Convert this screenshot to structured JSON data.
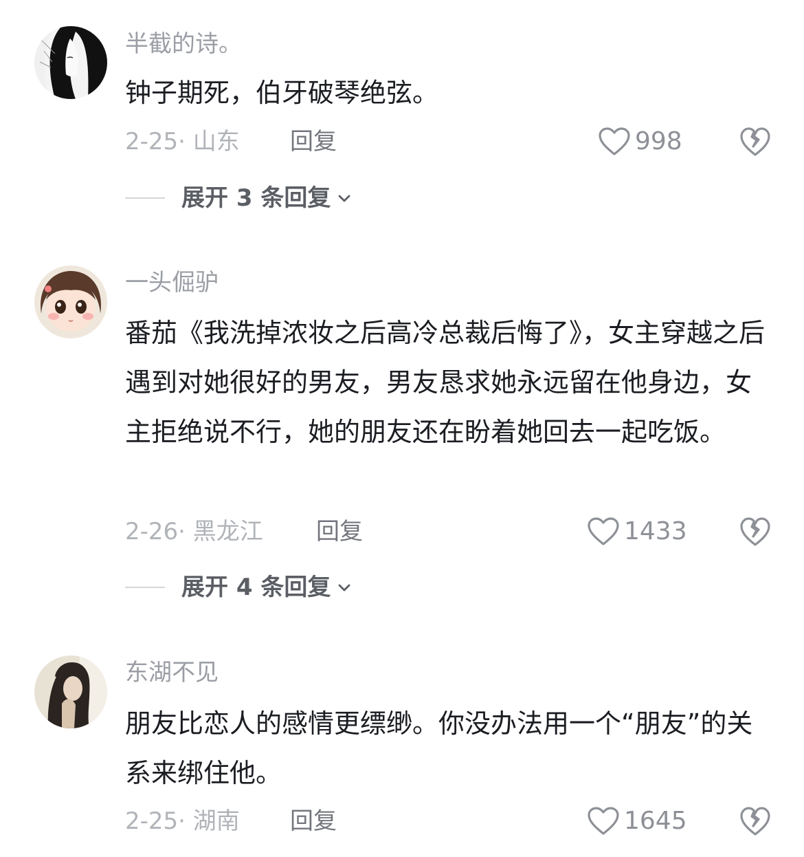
{
  "comments": [
    {
      "username": "半截的诗。",
      "text": "钟子期死，伯牙破琴绝弦。",
      "meta": "2-25· 山东",
      "reply_label": "回复",
      "likes": "998",
      "expand_label": "展开 3 条回复"
    },
    {
      "username": "一头倔驴",
      "text": "番茄《我洗掉浓妆之后高冷总裁后悔了》，女主穿越之后遇到对她很好的男友，男友恳求她永远留在他身边，女主拒绝说不行，她的朋友还在盼着她回去一起吃饭。",
      "meta": "2-26· 黑龙江",
      "reply_label": "回复",
      "likes": "1433",
      "expand_label": "展开 4 条回复"
    },
    {
      "username": "东湖不见",
      "text": "朋友比恋人的感情更缥缈。你没办法用一个“朋友”的关系来绑住他。",
      "meta": "2-25· 湖南",
      "reply_label": "回复",
      "likes": "1645"
    }
  ],
  "icons": {
    "like": "heart-outline-icon",
    "dislike": "broken-heart-icon",
    "expand": "chevron-down-icon"
  },
  "colors": {
    "text": "#1b1d22",
    "username": "#9b9ea5",
    "meta": "#b0b3b8",
    "icon": "#8d9096"
  }
}
